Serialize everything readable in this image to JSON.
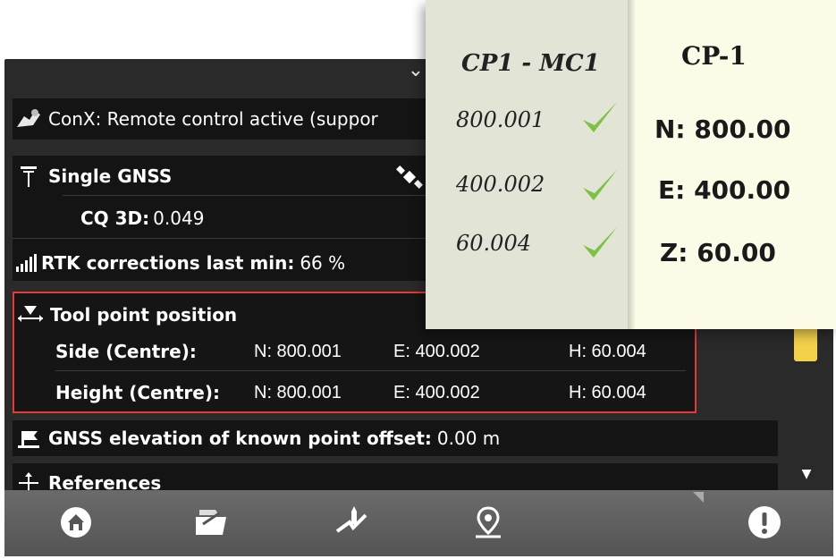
{
  "statusRows": {
    "conx": "ConX: Remote control active (suppor",
    "gnss_title": "Single GNSS",
    "cq_label": "CQ 3D:",
    "cq_value": "0.049",
    "rtk_label": "RTK corrections last min:",
    "rtk_value": "66 %"
  },
  "toolPoint": {
    "title": "Tool point position",
    "rows": [
      {
        "label": "Side (Centre):",
        "n": "N: 800.001",
        "e": "E: 400.002",
        "h": "H: 60.004"
      },
      {
        "label": "Height (Centre):",
        "n": "N: 800.001",
        "e": "E: 400.002",
        "h": "H: 60.004"
      }
    ]
  },
  "elevation": {
    "label": "GNSS elevation of known point offset:",
    "value": "0.00 m"
  },
  "references": {
    "label": "References"
  },
  "note": {
    "left_title": "CP1 - MC1",
    "measurements": [
      "800.001",
      "400.002",
      "60.004"
    ],
    "right_title": "CP-1",
    "control": [
      "N: 800.00",
      "E: 400.00",
      "Z: 60.00"
    ]
  },
  "icons": {
    "conx": "conx-remote-icon",
    "gnss": "gnss-antenna-icon",
    "satellite": "satellite-icon",
    "rtk": "signal-bars-icon",
    "tool": "tool-point-icon",
    "elevation": "flag-elevation-icon",
    "references": "references-icon",
    "nav": [
      "home-icon",
      "project-icon",
      "measure-icon",
      "location-pin-icon",
      "alert-icon"
    ]
  },
  "colors": {
    "highlight": "#e53935",
    "scroll_thumb": "#f2d04a",
    "check": "#7dc242"
  }
}
